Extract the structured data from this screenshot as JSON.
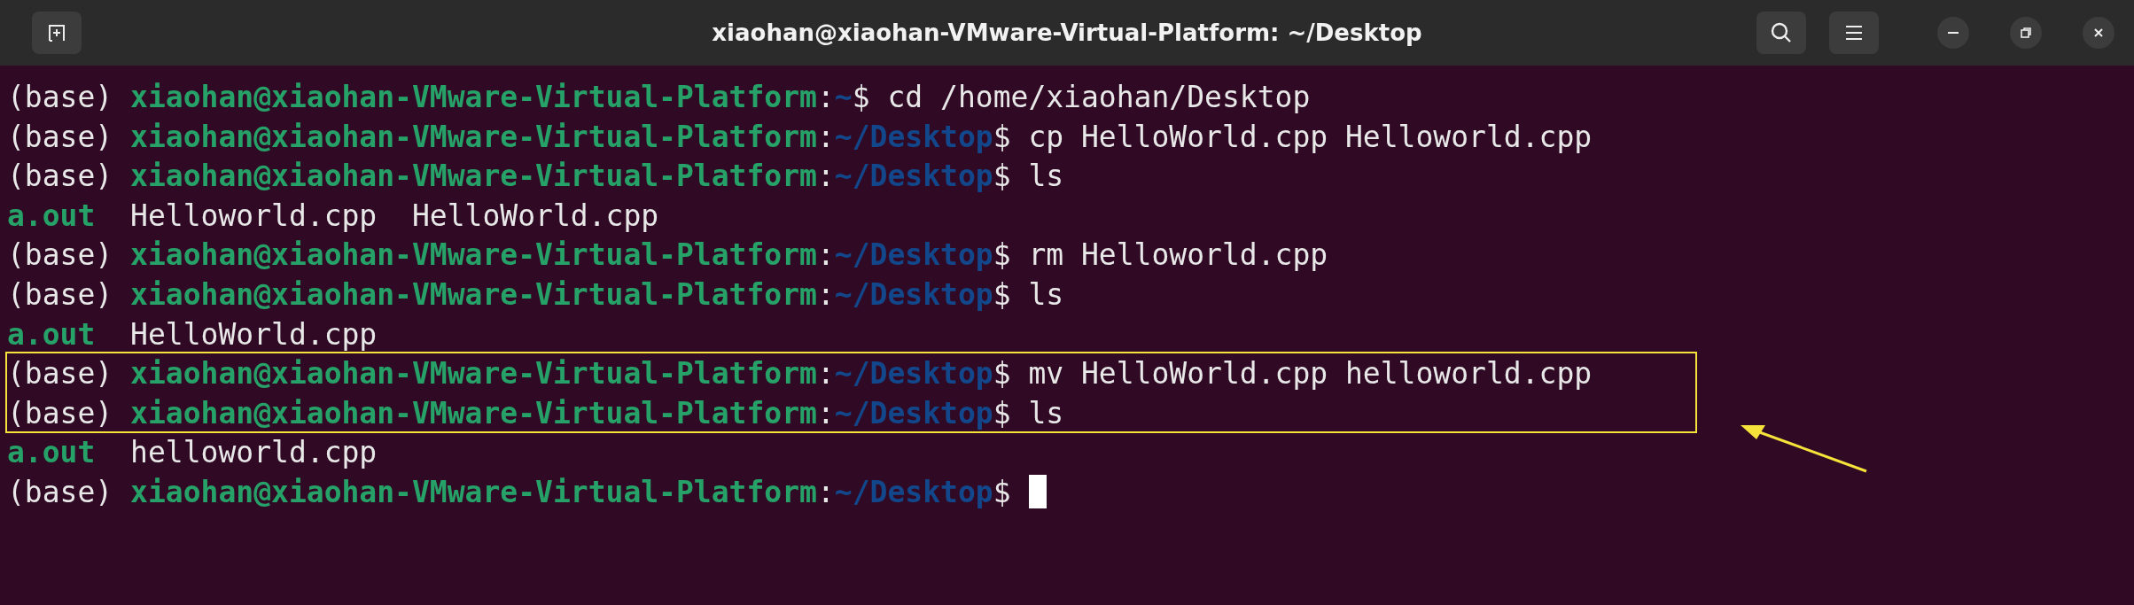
{
  "window": {
    "title": "xiaohan@xiaohan-VMware-Virtual-Platform: ~/Desktop"
  },
  "lines": [
    {
      "kind": "prompt",
      "env": "(base)",
      "user_host": "xiaohan@xiaohan-VMware-Virtual-Platform",
      "colon": ":",
      "path": "~",
      "symbol": "$",
      "command": "cd /home/xiaohan/Desktop"
    },
    {
      "kind": "prompt",
      "env": "(base)",
      "user_host": "xiaohan@xiaohan-VMware-Virtual-Platform",
      "colon": ":",
      "path": "~/Desktop",
      "symbol": "$",
      "command": "cp HelloWorld.cpp Helloworld.cpp"
    },
    {
      "kind": "prompt",
      "env": "(base)",
      "user_host": "xiaohan@xiaohan-VMware-Virtual-Platform",
      "colon": ":",
      "path": "~/Desktop",
      "symbol": "$",
      "command": "ls"
    },
    {
      "kind": "output",
      "items": [
        {
          "kind": "exec",
          "name": "a.out"
        },
        {
          "kind": "file",
          "name": "Helloworld.cpp"
        },
        {
          "kind": "file",
          "name": "HelloWorld.cpp"
        }
      ]
    },
    {
      "kind": "prompt",
      "env": "(base)",
      "user_host": "xiaohan@xiaohan-VMware-Virtual-Platform",
      "colon": ":",
      "path": "~/Desktop",
      "symbol": "$",
      "command": "rm Helloworld.cpp"
    },
    {
      "kind": "prompt",
      "env": "(base)",
      "user_host": "xiaohan@xiaohan-VMware-Virtual-Platform",
      "colon": ":",
      "path": "~/Desktop",
      "symbol": "$",
      "command": "ls"
    },
    {
      "kind": "output",
      "items": [
        {
          "kind": "exec",
          "name": "a.out"
        },
        {
          "kind": "file",
          "name": "HelloWorld.cpp"
        }
      ]
    },
    {
      "kind": "prompt",
      "env": "(base)",
      "user_host": "xiaohan@xiaohan-VMware-Virtual-Platform",
      "colon": ":",
      "path": "~/Desktop",
      "symbol": "$",
      "command": "mv HelloWorld.cpp helloworld.cpp"
    },
    {
      "kind": "prompt",
      "env": "(base)",
      "user_host": "xiaohan@xiaohan-VMware-Virtual-Platform",
      "colon": ":",
      "path": "~/Desktop",
      "symbol": "$",
      "command": "ls"
    },
    {
      "kind": "output",
      "items": [
        {
          "kind": "exec",
          "name": "a.out"
        },
        {
          "kind": "file",
          "name": "helloworld.cpp"
        }
      ]
    },
    {
      "kind": "prompt",
      "env": "(base)",
      "user_host": "xiaohan@xiaohan-VMware-Virtual-Platform",
      "colon": ":",
      "path": "~/Desktop",
      "symbol": "$",
      "cursor": true
    }
  ]
}
